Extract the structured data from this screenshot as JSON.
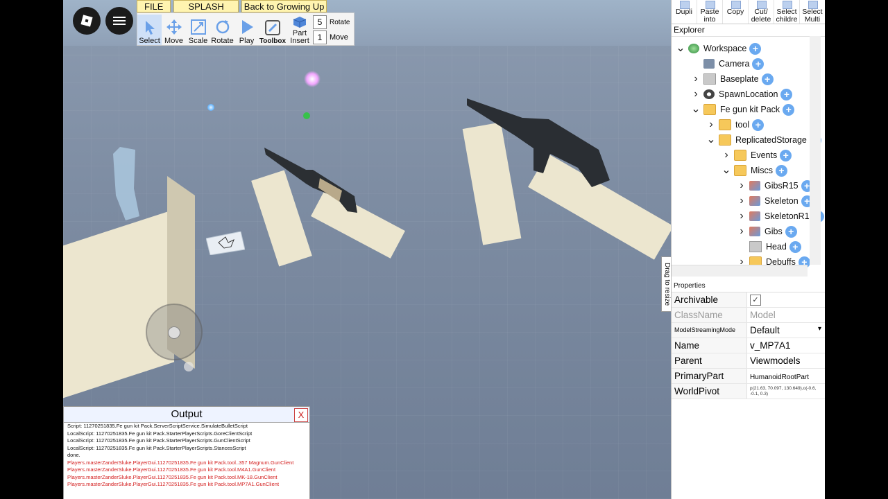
{
  "menu": {
    "file": "FILE",
    "splash": "SPLASH",
    "back": "Back to Growing Up"
  },
  "tools": [
    {
      "label": "Select",
      "icon": "cursor-icon"
    },
    {
      "label": "Move",
      "icon": "move-arrows-icon"
    },
    {
      "label": "Scale",
      "icon": "scale-icon"
    },
    {
      "label": "Rotate",
      "icon": "rotate-icon"
    },
    {
      "label": "Play",
      "icon": "play-icon"
    },
    {
      "label": "Toolbox",
      "icon": "toolbox-icon"
    }
  ],
  "part_insert": {
    "line1": "Part",
    "line2": "Insert"
  },
  "step": {
    "rotate_value": "5",
    "rotate_label": "Rotate",
    "move_value": "1",
    "move_label": "Move"
  },
  "ribbon": [
    {
      "label": "Dupli"
    },
    {
      "label": "Paste into"
    },
    {
      "label": "Copy"
    },
    {
      "label": "Cut/ delete"
    },
    {
      "label": "Select childre"
    },
    {
      "label": "Select Multi"
    }
  ],
  "explorer": {
    "title": "Explorer",
    "items": [
      {
        "label": "Workspace",
        "depth": 0,
        "expand": "open",
        "icon": "globe-icon"
      },
      {
        "label": "Camera",
        "depth": 1,
        "expand": "none",
        "icon": "camera-icon"
      },
      {
        "label": "Baseplate",
        "depth": 1,
        "expand": "closed",
        "icon": "part-icon"
      },
      {
        "label": "SpawnLocation",
        "depth": 1,
        "expand": "closed",
        "icon": "gear-icon"
      },
      {
        "label": "Fe gun kit Pack",
        "depth": 1,
        "expand": "open",
        "icon": "folder-icon"
      },
      {
        "label": "tool",
        "depth": 2,
        "expand": "closed",
        "icon": "folder-icon"
      },
      {
        "label": "ReplicatedStorage",
        "depth": 2,
        "expand": "open",
        "icon": "folder-icon"
      },
      {
        "label": "Events",
        "depth": 3,
        "expand": "closed",
        "icon": "folder-icon"
      },
      {
        "label": "Miscs",
        "depth": 3,
        "expand": "open",
        "icon": "folder-icon"
      },
      {
        "label": "GibsR15",
        "depth": 4,
        "expand": "closed",
        "icon": "model-icon"
      },
      {
        "label": "Skeleton",
        "depth": 4,
        "expand": "closed",
        "icon": "model-icon"
      },
      {
        "label": "SkeletonR1",
        "depth": 4,
        "expand": "closed",
        "icon": "model-icon"
      },
      {
        "label": "Gibs",
        "depth": 4,
        "expand": "closed",
        "icon": "model-icon"
      },
      {
        "label": "Head",
        "depth": 4,
        "expand": "none",
        "icon": "part-icon"
      },
      {
        "label": "Debuffs",
        "depth": 4,
        "expand": "closed",
        "icon": "folder-icon"
      }
    ]
  },
  "drag_label": "Drag to resize",
  "properties": {
    "title": "Properties",
    "rows": [
      {
        "key": "Archivable",
        "value": "✓",
        "style": "check"
      },
      {
        "key": "ClassName",
        "value": "Model",
        "style": "grey"
      },
      {
        "key": "ModelStreamingMode",
        "value": "Default",
        "style": "dropdown"
      },
      {
        "key": "Name",
        "value": "v_MP7A1",
        "style": "normal"
      },
      {
        "key": "Parent",
        "value": "Viewmodels",
        "style": "normal"
      },
      {
        "key": "PrimaryPart",
        "value": "HumanoidRootPart",
        "style": "small"
      },
      {
        "key": "WorldPivot",
        "value": "p(21.63, 70.097, 130.649),o(-0.6, -0.1, 0.3)",
        "style": "tiny"
      }
    ]
  },
  "output": {
    "title": "Output",
    "close": "X",
    "lines": [
      {
        "text": "Script: 11270251835.Fe gun kit Pack.ServerScriptService.SimulateBulletScript",
        "error": false
      },
      {
        "text": "LocalScript: 11270251835.Fe gun kit Pack.StarterPlayerScripts.GoreClientScript",
        "error": false
      },
      {
        "text": "LocalScript: 11270251835.Fe gun kit Pack.StarterPlayerScripts.GunClientScript",
        "error": false
      },
      {
        "text": "LocalScript: 11270251835.Fe gun kit Pack.StarterPlayerScripts.StancesScript",
        "error": false
      },
      {
        "text": "done.",
        "error": false
      },
      {
        "text": "Players.masterZanderSluke.PlayerGui.11270251835.Fe gun kit Pack.tool..357 Magnum.GunClient",
        "error": true
      },
      {
        "text": "Players.masterZanderSluke.PlayerGui.11270251835.Fe gun kit Pack.tool.M4A1.GunClient",
        "error": true
      },
      {
        "text": "Players.masterZanderSluke.PlayerGui.11270251835.Fe gun kit Pack.tool.MK-18.GunClient",
        "error": true
      },
      {
        "text": "Players.masterZanderSluke.PlayerGui.11270251835.Fe gun kit Pack.tool.MP7A1.GunClient",
        "error": true
      }
    ]
  }
}
